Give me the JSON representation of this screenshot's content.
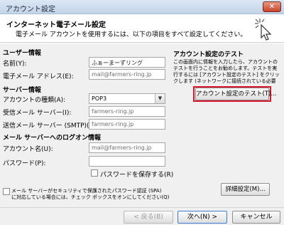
{
  "window": {
    "title": "アカウント設定",
    "close_glyph": "✕"
  },
  "header": {
    "title": "インターネット電子メール設定",
    "subtitle": "電子メール アカウントを使用するには、以下の項目をすべて設定してください。",
    "icon": "cursor-sparkle-icon"
  },
  "user_info": {
    "heading": "ユーザー情報",
    "name_label": "名前(Y):",
    "name_value": "ふぁーまーずリング",
    "email_label": "電子メール アドレス(E):",
    "email_value": "mail@farmers-ring.jp"
  },
  "server_info": {
    "heading": "サーバー情報",
    "account_type_label": "アカウントの種類(A):",
    "account_type_value": "POP3",
    "incoming_label": "受信メール サーバー(I):",
    "incoming_value": "farmers-ring.jp",
    "outgoing_label": "送信メール サーバー (SMTP)(O):",
    "outgoing_value": "farmers-ring.jp"
  },
  "logon_info": {
    "heading": "メール サーバーへのログオン情報",
    "account_name_label": "アカウント名(U):",
    "account_name_value": "mail@farmers-ring.jp",
    "password_label": "パスワード(P):",
    "password_value": "",
    "save_password_label": "パスワードを保存する(R)"
  },
  "spa": {
    "line1": "メール サーバーがセキュリティで保護されたパスワード認証 (SPA)",
    "line2": "に対応している場合には、チェック ボックスをオンにしてください(Q)"
  },
  "test_settings": {
    "heading": "アカウント設定のテスト",
    "description": "この画面内に情報を入力したら、アカウントのテストを行うことをお勧めします。テストを実行するには [アカウント設定のテスト] をクリックします (ネットワークに接続されている必要があります)。",
    "test_button": "アカウント設定のテスト(T)..."
  },
  "buttons": {
    "more_settings": "詳細設定(M)...",
    "back": "< 戻る(B)",
    "next": "次へ(N) >",
    "cancel": "キャンセル"
  },
  "colors": {
    "highlight": "#d6162a",
    "accent_title": "#c3d4e8"
  }
}
